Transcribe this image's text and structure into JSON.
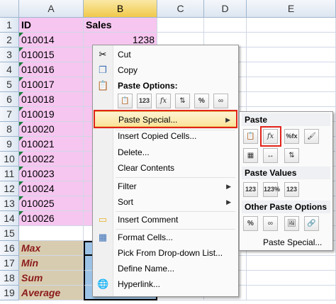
{
  "columns": [
    "A",
    "B",
    "C",
    "D",
    "E"
  ],
  "rows": [
    "1",
    "2",
    "3",
    "4",
    "5",
    "6",
    "7",
    "8",
    "9",
    "10",
    "11",
    "12",
    "13",
    "14",
    "15",
    "16",
    "17",
    "18",
    "19"
  ],
  "header": {
    "id": "ID",
    "sales": "Sales"
  },
  "ids": [
    "010014",
    "010015",
    "010016",
    "010017",
    "010018",
    "010019",
    "010020",
    "010021",
    "010022",
    "010023",
    "010024",
    "010025",
    "010026"
  ],
  "first_sales": "1238",
  "stats": [
    "Max",
    "Min",
    "Sum",
    "Average"
  ],
  "menu": {
    "cut": "Cut",
    "copy": "Copy",
    "paste_options": "Paste Options:",
    "paste_special": "Paste Special...",
    "insert_copied_cells": "Insert Copied Cells...",
    "delete": "Delete...",
    "clear_contents": "Clear Contents",
    "filter": "Filter",
    "sort": "Sort",
    "insert_comment": "Insert Comment",
    "format_cells": "Format Cells...",
    "pick_from_list": "Pick From Drop-down List...",
    "define_name": "Define Name...",
    "hyperlink": "Hyperlink..."
  },
  "submenu": {
    "paste": "Paste",
    "paste_values": "Paste Values",
    "other_paste_options": "Other Paste Options",
    "paste_special": "Paste Special..."
  },
  "paste_option_icons": [
    "paste-icon",
    "paste-values-123-icon",
    "paste-formulas-fx-icon",
    "paste-transpose-icon",
    "paste-formatting-percent-icon",
    "paste-link-icon"
  ],
  "colors": {
    "pink": "#f6c6f0",
    "tan": "#d8ccb0",
    "highlight": "#fbe49a",
    "red_outline": "#e2231a"
  }
}
